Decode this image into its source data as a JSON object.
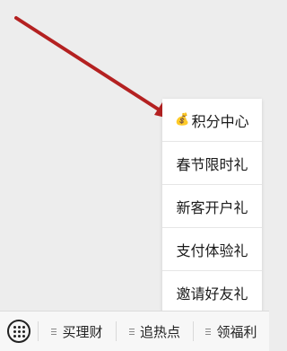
{
  "popup_menu": {
    "items": [
      {
        "label": "积分中心",
        "icon": "money-bag-icon",
        "icon_glyph": "💰"
      },
      {
        "label": "春节限时礼"
      },
      {
        "label": "新客开户礼"
      },
      {
        "label": "支付体验礼"
      },
      {
        "label": "邀请好友礼"
      }
    ]
  },
  "bottom_menu": {
    "keyboard_icon": "keyboard-icon",
    "tabs": [
      {
        "label": "买理财"
      },
      {
        "label": "追热点"
      },
      {
        "label": "领福利"
      }
    ]
  },
  "annotation": {
    "arrow_color": "#b42121"
  }
}
